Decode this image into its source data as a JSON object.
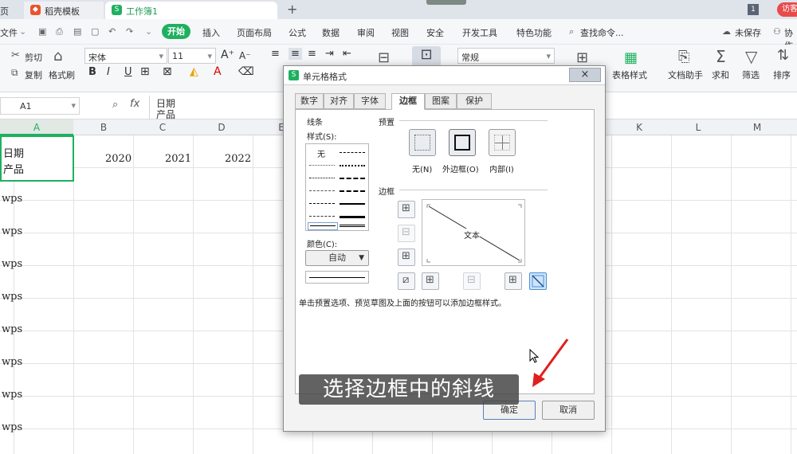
{
  "tabs": {
    "left_label": "页",
    "docer": "稻壳模板",
    "workbook": "工作簿1",
    "add": "+",
    "badge": "1",
    "visitor": "访客"
  },
  "menu": {
    "file": "文件",
    "start": "开始",
    "items": [
      "插入",
      "页面布局",
      "公式",
      "数据",
      "审阅",
      "视图",
      "安全",
      "开发工具",
      "特色功能"
    ],
    "search": "查找命令...",
    "cloud": "未保存",
    "coop": "协作"
  },
  "toolbar": {
    "cut": "剪切",
    "copy": "复制",
    "format_painter": "格式刷",
    "font_name": "宋体",
    "font_size": "11",
    "num_format": "常规",
    "bold": "B",
    "italic": "I",
    "underline": "U",
    "table_style": "表格样式",
    "doc_helper": "文档助手",
    "sum": "求和",
    "filter": "筛选",
    "sort": "排序"
  },
  "formula": {
    "name_box": "A1",
    "fx": "fx",
    "content_line1": "日期",
    "content_line2": "产品"
  },
  "columns": [
    "A",
    "B",
    "C",
    "D",
    "E",
    "K",
    "L",
    "M"
  ],
  "cells": {
    "a1_line1": "日期",
    "a1_line2": "产品",
    "b1": "2020",
    "c1": "2021",
    "d1": "2022",
    "rows": [
      "wps",
      "wps",
      "wps",
      "wps",
      "wps",
      "wps",
      "wps",
      "wps"
    ]
  },
  "dialog": {
    "title": "单元格格式",
    "close": "×",
    "tabs": [
      "数字",
      "对齐",
      "字体",
      "边框",
      "图案",
      "保护"
    ],
    "active_tab": "边框",
    "line_group": "线条",
    "style_label": "样式(S):",
    "none_label": "无",
    "color_label": "颜色(C):",
    "color_value": "自动",
    "preset_group": "预置",
    "presets": [
      "无(N)",
      "外边框(O)",
      "内部(I)"
    ],
    "border_group": "边框",
    "preview_text": "文本",
    "hint": "单击预置选项、预览草图及上面的按钮可以添加边框样式。",
    "ok": "确定",
    "cancel": "取消"
  },
  "caption": "选择边框中的斜线",
  "colors": {
    "accent": "#1fb05f",
    "arrow": "#e02020",
    "diag_selected": "#4a90d9"
  }
}
